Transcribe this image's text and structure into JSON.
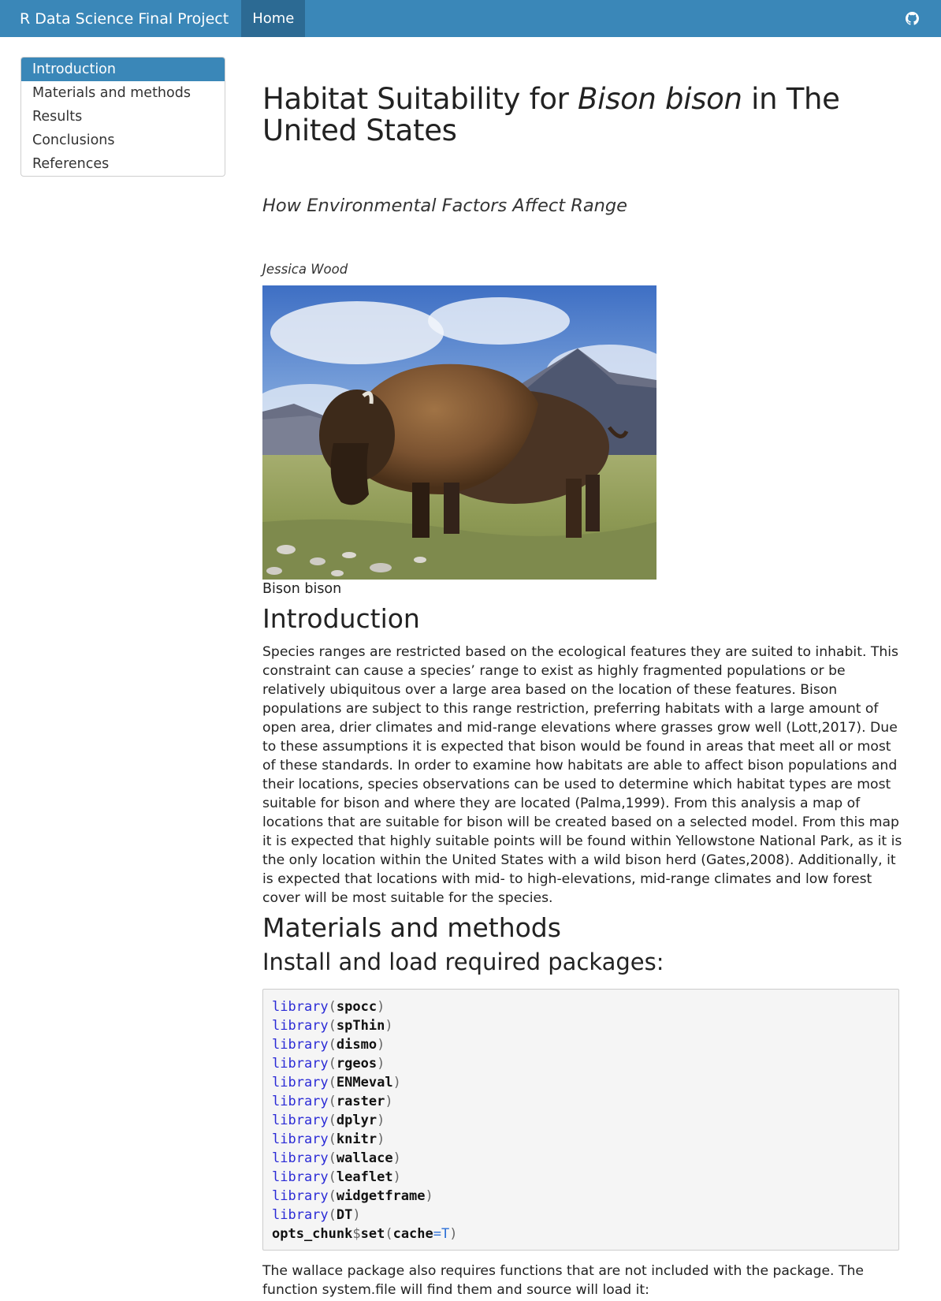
{
  "navbar": {
    "brand": "R Data Science Final Project",
    "home": "Home",
    "icon": "github-icon"
  },
  "toc": {
    "items": [
      {
        "label": "Introduction",
        "active": true
      },
      {
        "label": "Materials and methods",
        "active": false
      },
      {
        "label": "Results",
        "active": false
      },
      {
        "label": "Conclusions",
        "active": false
      },
      {
        "label": "References",
        "active": false
      }
    ]
  },
  "header": {
    "title_pre": "Habitat Suitability for ",
    "title_em": "Bison bison",
    "title_post": " in The United States",
    "subtitle": "How Environmental Factors Affect Range",
    "author": "Jessica Wood"
  },
  "figure": {
    "caption": "Bison bison"
  },
  "intro": {
    "heading": "Introduction",
    "body": "Species ranges are restricted based on the ecological features they are suited to inhabit. This constraint can cause a species’ range to exist as highly fragmented populations or be relatively ubiquitous over a large area based on the location of these features. Bison populations are subject to this range restriction, preferring habitats with a large amount of open area, drier climates and mid-range elevations where grasses grow well (Lott,2017). Due to these assumptions it is expected that bison would be found in areas that meet all or most of these standards. In order to examine how habitats are able to affect bison populations and their locations, species observations can be used to determine which habitat types are most suitable for bison and where they are located (Palma,1999). From this analysis a map of locations that are suitable for bison will be created based on a selected model. From this map it is expected that highly suitable points will be found within Yellowstone National Park, as it is the only location within the United States with a wild bison herd (Gates,2008). Additionally, it is expected that locations with mid- to high-elevations, mid-range climates and low forest cover will be most suitable for the species."
  },
  "methods": {
    "heading": "Materials and methods",
    "subheading": "Install and load required packages:",
    "code_lines": [
      {
        "fn": "library",
        "arg": "spocc"
      },
      {
        "fn": "library",
        "arg": "spThin"
      },
      {
        "fn": "library",
        "arg": "dismo"
      },
      {
        "fn": "library",
        "arg": "rgeos"
      },
      {
        "fn": "library",
        "arg": "ENMeval"
      },
      {
        "fn": "library",
        "arg": "raster"
      },
      {
        "fn": "library",
        "arg": "dplyr"
      },
      {
        "fn": "library",
        "arg": "knitr"
      },
      {
        "fn": "library",
        "arg": "wallace"
      },
      {
        "fn": "library",
        "arg": "leaflet"
      },
      {
        "fn": "library",
        "arg": "widgetframe"
      },
      {
        "fn": "library",
        "arg": "DT"
      }
    ],
    "last_line": {
      "obj": "opts_chunk",
      "op": "$",
      "fn": "set",
      "open": "(",
      "arg": "cache",
      "eq": "=",
      "val": "T",
      "close": ")"
    },
    "body_after": "The wallace package also requires functions that are not included with the package. The function system.file will find them and source will load it:"
  }
}
